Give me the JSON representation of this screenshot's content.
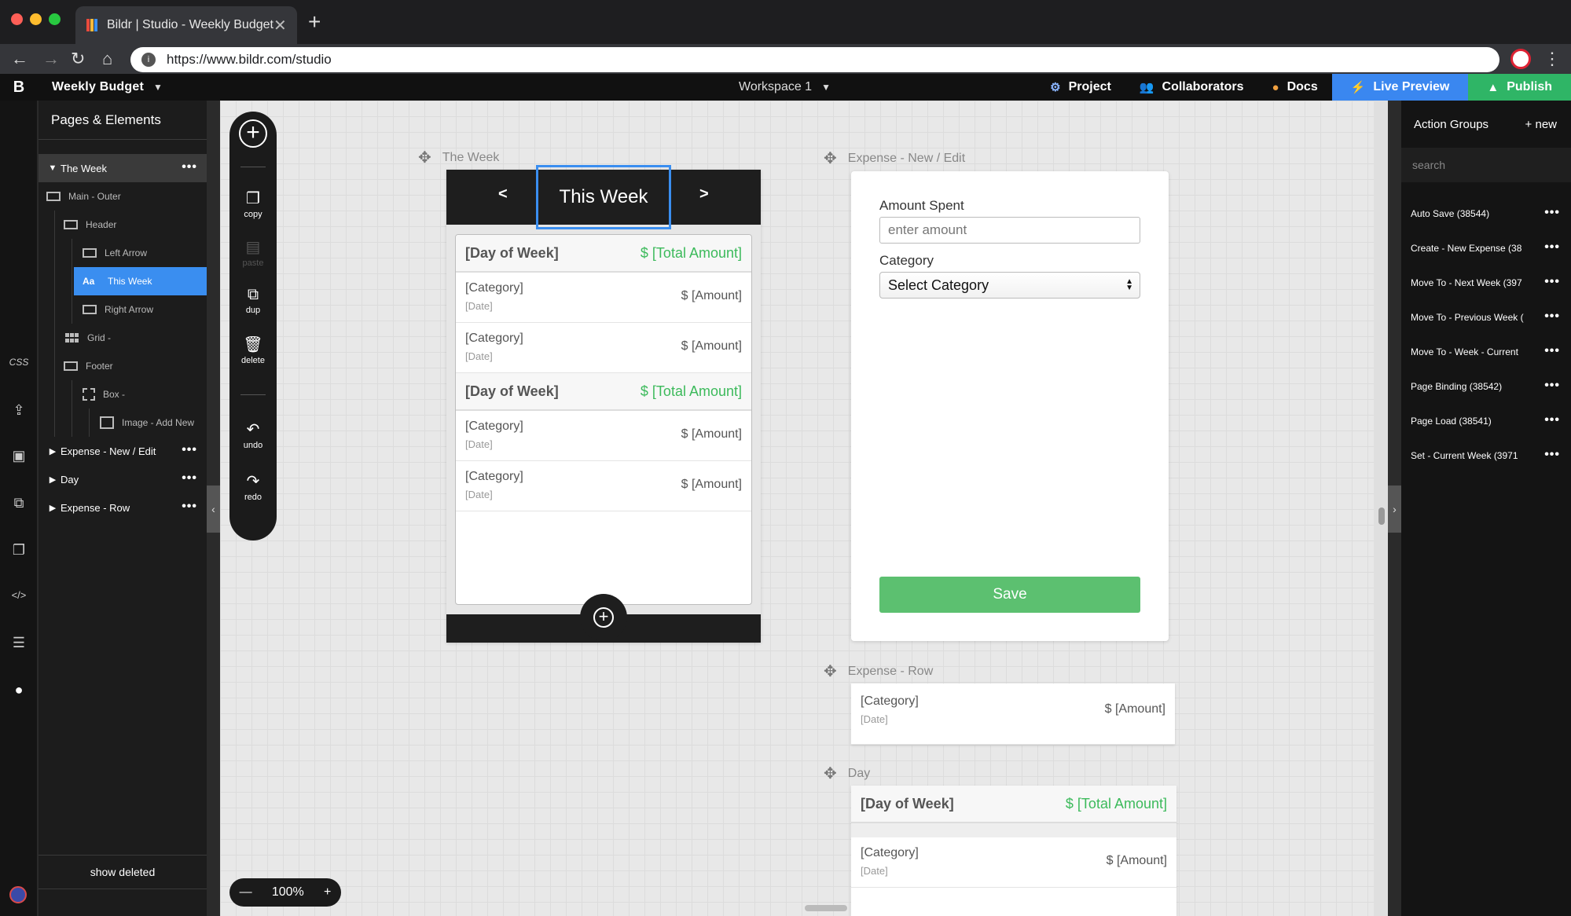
{
  "browser": {
    "tab_title": "Bildr | Studio - Weekly Budget",
    "tab_close": "✕",
    "new_tab": "+",
    "url": "https://www.bildr.com/studio"
  },
  "app": {
    "logo": "B",
    "project_title": "Weekly Budget",
    "workspace": "Workspace 1",
    "top_actions": {
      "project": "Project",
      "collaborators": "Collaborators",
      "docs": "Docs",
      "live_preview": "Live Preview",
      "publish": "Publish"
    }
  },
  "rail": {
    "css": "CSS"
  },
  "pages_panel": {
    "title": "Pages & Elements",
    "show_deleted": "show deleted",
    "items": [
      {
        "label": "The Week"
      },
      {
        "label": "Main - Outer"
      },
      {
        "label": "Header"
      },
      {
        "label": "Left Arrow"
      },
      {
        "label": "This Week"
      },
      {
        "label": "Right Arrow"
      },
      {
        "label": "Grid -"
      },
      {
        "label": "Footer"
      },
      {
        "label": "Box -"
      },
      {
        "label": "Image - Add New"
      },
      {
        "label": "Expense - New / Edit"
      },
      {
        "label": "Day"
      },
      {
        "label": "Expense - Row"
      }
    ],
    "text_icon": "Aa",
    "more": "•••"
  },
  "tools": {
    "copy": "copy",
    "paste": "paste",
    "dup": "dup",
    "delete": "delete",
    "undo": "undo",
    "redo": "redo"
  },
  "zoom": {
    "minus": "—",
    "value": "100%",
    "plus": "+"
  },
  "frames": {
    "week_label": "The Week",
    "expense_label": "Expense - New / Edit",
    "row_label": "Expense - Row",
    "day_label": "Day"
  },
  "week": {
    "prev": "<",
    "title": "This Week",
    "next": ">",
    "days": [
      {
        "name": "[Day of Week]",
        "total": "$ [Total Amount]",
        "expenses": [
          {
            "category": "[Category]",
            "date": "[Date]",
            "amount": "$ [Amount]"
          },
          {
            "category": "[Category]",
            "date": "[Date]",
            "amount": "$ [Amount]"
          }
        ]
      },
      {
        "name": "[Day of Week]",
        "total": "$ [Total Amount]",
        "expenses": [
          {
            "category": "[Category]",
            "date": "[Date]",
            "amount": "$ [Amount]"
          },
          {
            "category": "[Category]",
            "date": "[Date]",
            "amount": "$ [Amount]"
          }
        ]
      }
    ]
  },
  "expense_form": {
    "amount_label": "Amount Spent",
    "amount_placeholder": "enter amount",
    "category_label": "Category",
    "category_selected": "Select Category",
    "save": "Save"
  },
  "expense_row": {
    "category": "[Category]",
    "date": "[Date]",
    "amount": "$ [Amount]"
  },
  "day_frame": {
    "name": "[Day of Week]",
    "total": "$ [Total Amount]",
    "expense": {
      "category": "[Category]",
      "date": "[Date]",
      "amount": "$ [Amount]"
    }
  },
  "action_groups": {
    "title": "Action Groups",
    "new": "+ new",
    "search_placeholder": "search",
    "items": [
      "Auto Save (38544)",
      "Create - New Expense (38",
      "Move To - Next Week (397",
      "Move To - Previous Week (",
      "Move To - Week - Current",
      "Page Binding (38542)",
      "Page Load (38541)",
      "Set - Current Week (3971"
    ]
  },
  "colors": {
    "accent_blue": "#3a8ef0",
    "publish_green": "#2fb566",
    "total_green": "#3cba5b",
    "save_green": "#5cc070"
  }
}
